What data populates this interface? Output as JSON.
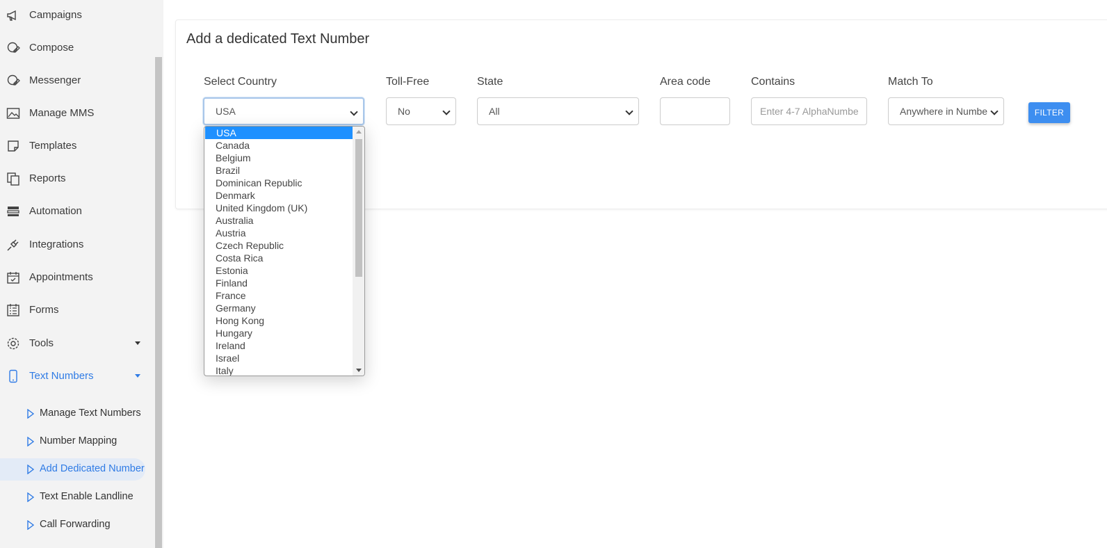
{
  "sidebar": {
    "items": [
      {
        "label": "Campaigns",
        "icon": "megaphone-icon"
      },
      {
        "label": "Compose",
        "icon": "compose-icon"
      },
      {
        "label": "Messenger",
        "icon": "messenger-icon"
      },
      {
        "label": "Manage MMS",
        "icon": "image-icon"
      },
      {
        "label": "Templates",
        "icon": "note-icon"
      },
      {
        "label": "Reports",
        "icon": "copy-icon"
      },
      {
        "label": "Automation",
        "icon": "server-icon"
      },
      {
        "label": "Integrations",
        "icon": "plug-icon"
      },
      {
        "label": "Appointments",
        "icon": "calendar-icon"
      },
      {
        "label": "Forms",
        "icon": "form-icon"
      },
      {
        "label": "Tools",
        "icon": "gear-icon"
      },
      {
        "label": "Text Numbers",
        "icon": "phone-icon"
      }
    ],
    "sub_items": [
      {
        "label": "Manage Text Numbers"
      },
      {
        "label": "Number Mapping"
      },
      {
        "label": "Add Dedicated Number"
      },
      {
        "label": "Text Enable Landline"
      },
      {
        "label": "Call Forwarding"
      }
    ]
  },
  "main": {
    "title": "Add a dedicated Text Number",
    "fields": {
      "country": {
        "label": "Select Country",
        "value": "USA"
      },
      "toll_free": {
        "label": "Toll-Free",
        "value": "No"
      },
      "state": {
        "label": "State",
        "value": "All"
      },
      "area_code": {
        "label": "Area code",
        "value": ""
      },
      "contains": {
        "label": "Contains",
        "placeholder": "Enter 4-7 AlphaNumbe"
      },
      "match_to": {
        "label": "Match To",
        "value": "Anywhere in Numbe"
      }
    },
    "filter_label": "FILTER"
  },
  "dropdown": {
    "options": [
      "USA",
      "Canada",
      "Belgium",
      "Brazil",
      "Dominican Republic",
      "Denmark",
      "United Kingdom (UK)",
      "Australia",
      "Austria",
      "Czech Republic",
      "Costa Rica",
      "Estonia",
      "Finland",
      "France",
      "Germany",
      "Hong Kong",
      "Hungary",
      "Ireland",
      "Israel",
      "Italy"
    ],
    "selected_index": 0
  },
  "colors": {
    "accent": "#2f7be5",
    "button": "#3d8ef0",
    "selected_option": "#1e90ff"
  }
}
